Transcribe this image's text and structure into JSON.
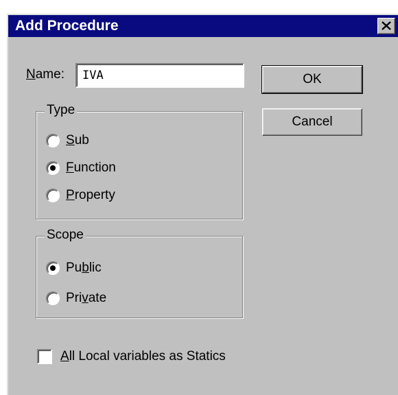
{
  "dialog": {
    "title": "Add Procedure",
    "close_icon": "close-icon"
  },
  "name_field": {
    "label_mnemonic": "N",
    "label_rest": "ame:",
    "value": "IVA"
  },
  "buttons": {
    "ok": "OK",
    "cancel": "Cancel"
  },
  "type_group": {
    "title": "Type",
    "options": [
      {
        "pre": "",
        "mnemonic": "S",
        "post": "ub",
        "checked": false
      },
      {
        "pre": "",
        "mnemonic": "F",
        "post": "unction",
        "checked": true
      },
      {
        "pre": "",
        "mnemonic": "P",
        "post": "roperty",
        "checked": false
      }
    ]
  },
  "scope_group": {
    "title": "Scope",
    "options": [
      {
        "pre": "Pu",
        "mnemonic": "b",
        "post": "lic",
        "checked": true
      },
      {
        "pre": "Pri",
        "mnemonic": "v",
        "post": "ate",
        "checked": false
      }
    ]
  },
  "statics_checkbox": {
    "mnemonic": "A",
    "rest": "ll Local variables as Statics",
    "checked": false
  },
  "colors": {
    "title_bar": "#0a0a80",
    "dialog_face": "#c0c0c0"
  }
}
